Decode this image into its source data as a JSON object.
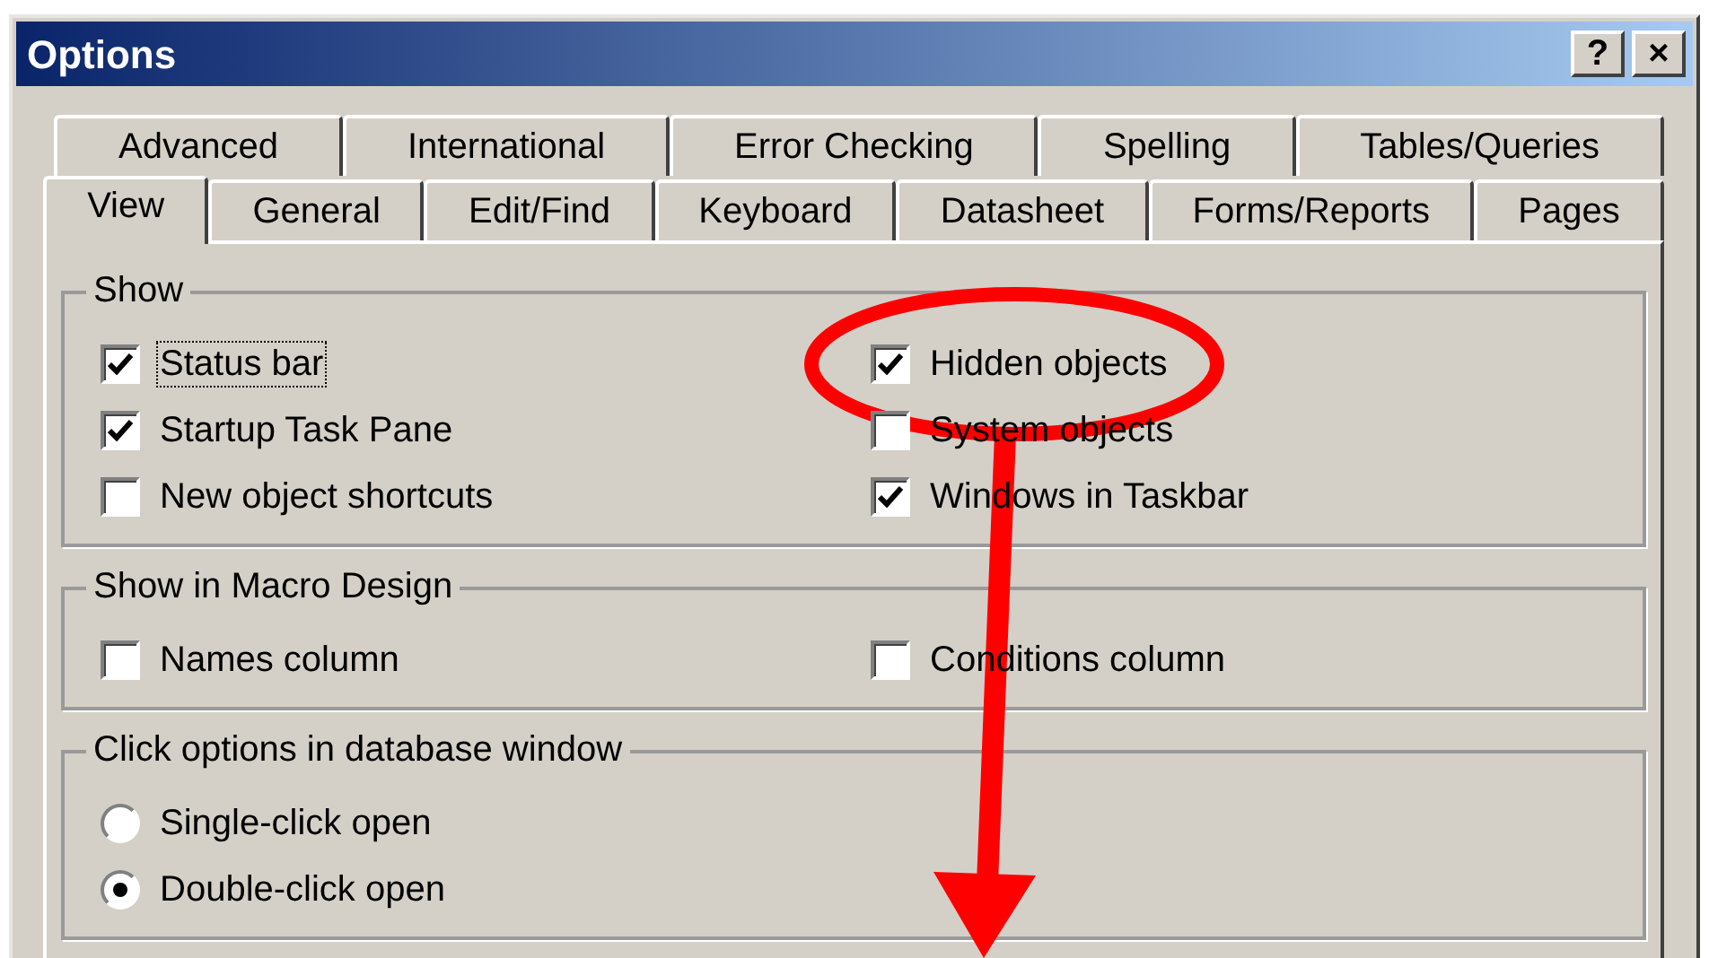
{
  "window": {
    "title": "Options",
    "title_buttons": [
      "?",
      "×"
    ]
  },
  "tab_rows": [
    {
      "tabs": [
        {
          "label": "Advanced",
          "selected": false
        },
        {
          "label": "International",
          "selected": false
        },
        {
          "label": "Error Checking",
          "selected": false
        },
        {
          "label": "Spelling",
          "selected": false
        },
        {
          "label": "Tables/Queries",
          "selected": false
        }
      ]
    },
    {
      "tabs": [
        {
          "label": "View",
          "selected": true
        },
        {
          "label": "General",
          "selected": false
        },
        {
          "label": "Edit/Find",
          "selected": false
        },
        {
          "label": "Keyboard",
          "selected": false
        },
        {
          "label": "Datasheet",
          "selected": false
        },
        {
          "label": "Forms/Reports",
          "selected": false
        },
        {
          "label": "Pages",
          "selected": false
        }
      ]
    }
  ],
  "groups": [
    {
      "title": "Show",
      "options": [
        {
          "kind": "checkbox",
          "label": "Status bar",
          "checked": true,
          "focused": true
        },
        {
          "kind": "checkbox",
          "label": "Hidden objects",
          "checked": true,
          "focused": false
        },
        {
          "kind": "checkbox",
          "label": "Startup Task Pane",
          "checked": true,
          "focused": false
        },
        {
          "kind": "checkbox",
          "label": "System objects",
          "checked": false,
          "focused": false
        },
        {
          "kind": "checkbox",
          "label": "New object shortcuts",
          "checked": false,
          "focused": false
        },
        {
          "kind": "checkbox",
          "label": "Windows in Taskbar",
          "checked": true,
          "focused": false
        }
      ]
    },
    {
      "title": "Show in Macro Design",
      "options": [
        {
          "kind": "checkbox",
          "label": "Names column",
          "checked": false,
          "focused": false
        },
        {
          "kind": "checkbox",
          "label": "Conditions column",
          "checked": false,
          "focused": false
        }
      ]
    },
    {
      "title": "Click options in database window",
      "options": [
        {
          "kind": "radio",
          "label": "Single-click open",
          "selected": false,
          "focused": false
        },
        {
          "kind": "radio",
          "label": "Double-click open",
          "selected": true,
          "focused": false
        }
      ]
    }
  ]
}
